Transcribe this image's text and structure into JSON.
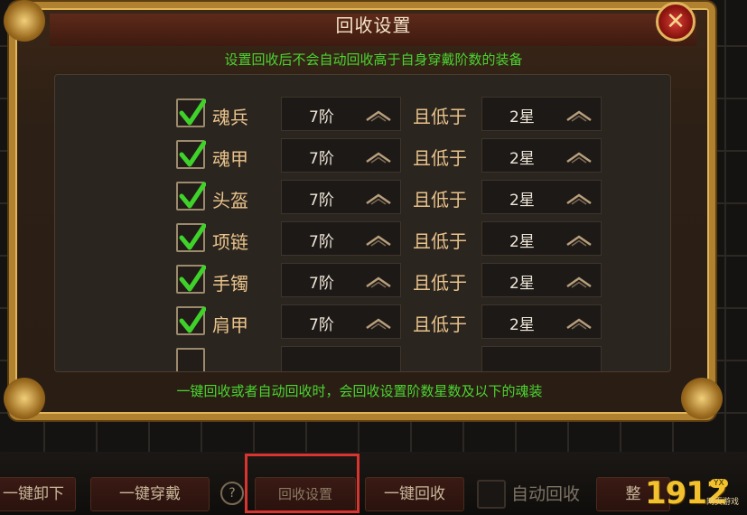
{
  "dialog": {
    "title": "回收设置",
    "close_icon": "close-x-icon",
    "hint_top": "设置回收后不会自动回收高于自身穿戴阶数的装备",
    "hint_bottom": "一键回收或者自动回收时，会回收设置阶数星数及以下的魂装",
    "rows": [
      {
        "label": "魂兵",
        "checked": true,
        "tier": "7阶",
        "connector": "且低于",
        "star": "2星"
      },
      {
        "label": "魂甲",
        "checked": true,
        "tier": "7阶",
        "connector": "且低于",
        "star": "2星"
      },
      {
        "label": "头盔",
        "checked": true,
        "tier": "7阶",
        "connector": "且低于",
        "star": "2星"
      },
      {
        "label": "项链",
        "checked": true,
        "tier": "7阶",
        "connector": "且低于",
        "star": "2星"
      },
      {
        "label": "手镯",
        "checked": true,
        "tier": "7阶",
        "connector": "且低于",
        "star": "2星"
      },
      {
        "label": "肩甲",
        "checked": true,
        "tier": "7阶",
        "connector": "且低于",
        "star": "2星"
      }
    ]
  },
  "bottom_bar": {
    "unequip_all": "一键卸下",
    "equip_all": "一键穿戴",
    "help": "?",
    "recycle_settings": "回收设置",
    "recycle_all": "一键回收",
    "auto_recycle": "自动回收",
    "sort": "整"
  },
  "logo": {
    "number": "1912",
    "sub": "网页游戏",
    "badge": "YX"
  },
  "colors": {
    "hint_green": "#4bd431",
    "label_gold": "#e8c28a",
    "frame_gold": "#b0822f",
    "highlight_red": "#d9342f"
  }
}
